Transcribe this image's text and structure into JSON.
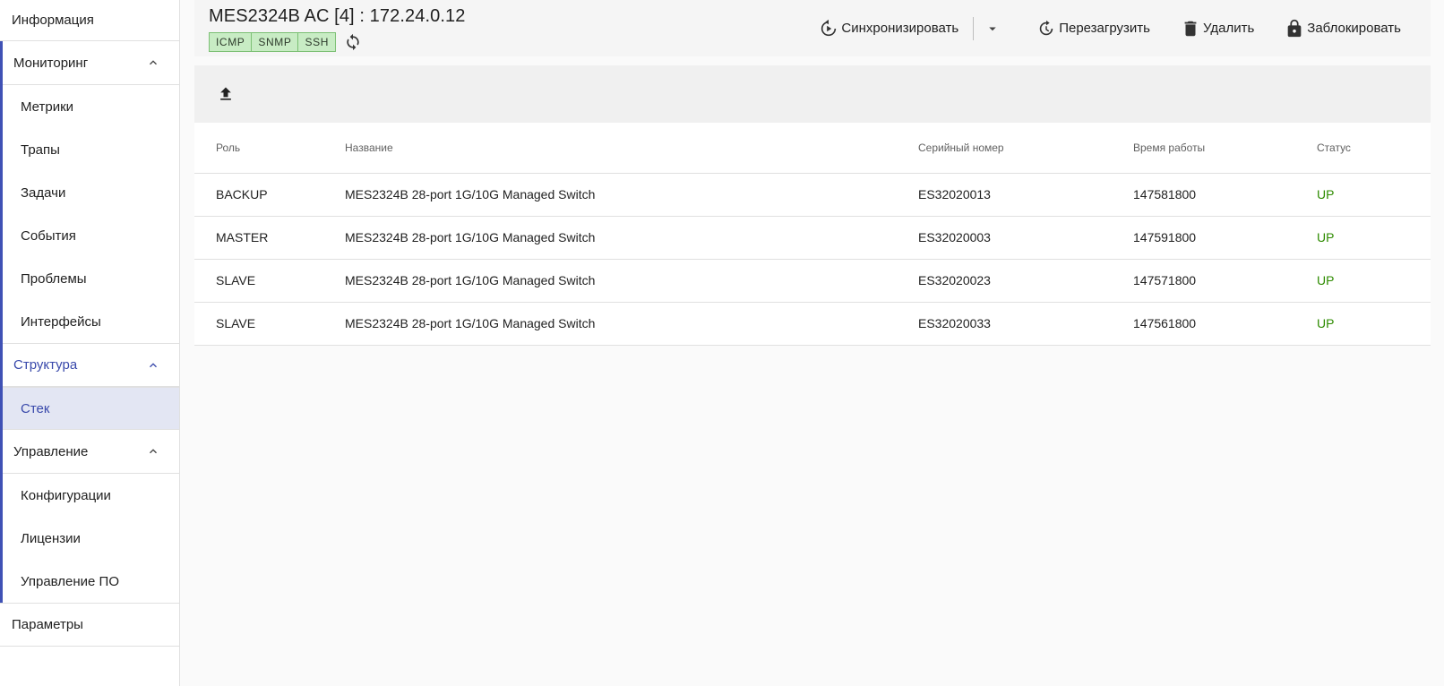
{
  "sidebar": {
    "info": "Информация",
    "monitoring": {
      "label": "Мониторинг",
      "items": [
        "Метрики",
        "Трапы",
        "Задачи",
        "События",
        "Проблемы",
        "Интерфейсы"
      ]
    },
    "structure": {
      "label": "Структура",
      "items": [
        "Стек"
      ]
    },
    "management": {
      "label": "Управление",
      "items": [
        "Конфигурации",
        "Лицензии",
        "Управление ПО"
      ]
    },
    "parameters": "Параметры"
  },
  "header": {
    "title": "MES2324B AC [4] : 172.24.0.12",
    "badges": [
      "ICMP",
      "SNMP",
      "SSH"
    ],
    "sync_label": "Синхронизировать",
    "reload_label": "Перезагрузить",
    "delete_label": "Удалить",
    "lock_label": "Заблокировать"
  },
  "table": {
    "headers": [
      "Роль",
      "Название",
      "Серийный номер",
      "Время работы",
      "Статус"
    ],
    "rows": [
      [
        "BACKUP",
        "MES2324B 28-port 1G/10G Managed Switch",
        "ES32020013",
        "147581800",
        "UP"
      ],
      [
        "MASTER",
        "MES2324B 28-port 1G/10G Managed Switch",
        "ES32020003",
        "147591800",
        "UP"
      ],
      [
        "SLAVE",
        "MES2324B 28-port 1G/10G Managed Switch",
        "ES32020023",
        "147571800",
        "UP"
      ],
      [
        "SLAVE",
        "MES2324B 28-port 1G/10G Managed Switch",
        "ES32020033",
        "147561800",
        "UP"
      ]
    ]
  },
  "colors": {
    "accent": "#3949ab",
    "status_up": "#2e8b00",
    "badge_bg": "#c8ecc4"
  }
}
